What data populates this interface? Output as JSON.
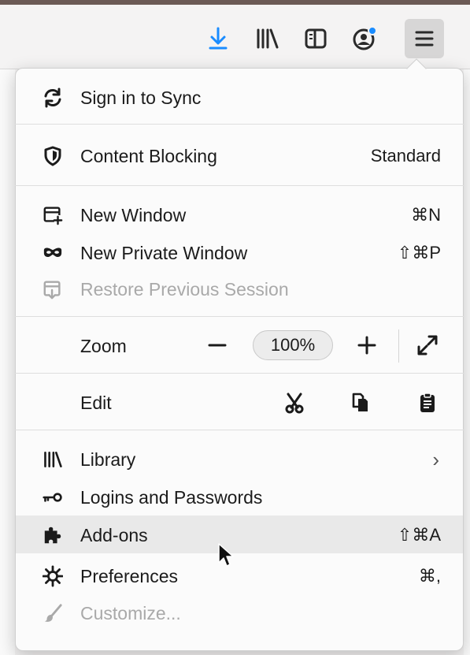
{
  "toolbar": {
    "icons": [
      "download-arrow-icon",
      "library-icon",
      "sidebar-icon",
      "account-icon",
      "hamburger-menu-icon"
    ],
    "accent": "#1a8cff"
  },
  "menu": {
    "sync": {
      "label": "Sign in to Sync",
      "icon": "sync-icon"
    },
    "content_blocking": {
      "label": "Content Blocking",
      "value": "Standard",
      "icon": "shield-icon"
    },
    "new_window": {
      "label": "New Window",
      "shortcut": "⌘N",
      "icon": "new-window-icon"
    },
    "new_private_window": {
      "label": "New Private Window",
      "shortcut": "⇧⌘P",
      "icon": "private-mask-icon"
    },
    "restore_session": {
      "label": "Restore Previous Session",
      "icon": "restore-session-icon",
      "disabled": true
    },
    "zoom": {
      "label": "Zoom",
      "value": "100%",
      "out_icon": "minus-icon",
      "in_icon": "plus-icon",
      "fullscreen_icon": "fullscreen-icon"
    },
    "edit": {
      "label": "Edit",
      "cut_icon": "scissors-icon",
      "copy_icon": "copy-icon",
      "paste_icon": "clipboard-icon"
    },
    "library": {
      "label": "Library",
      "icon": "library-icon",
      "arrow": "›"
    },
    "logins": {
      "label": "Logins and Passwords",
      "icon": "key-icon"
    },
    "addons": {
      "label": "Add-ons",
      "shortcut": "⇧⌘A",
      "icon": "puzzle-icon"
    },
    "preferences": {
      "label": "Preferences",
      "shortcut": "⌘,",
      "icon": "gear-icon"
    },
    "customize": {
      "label": "Customize...",
      "icon": "paintbrush-icon",
      "disabled": true
    }
  }
}
